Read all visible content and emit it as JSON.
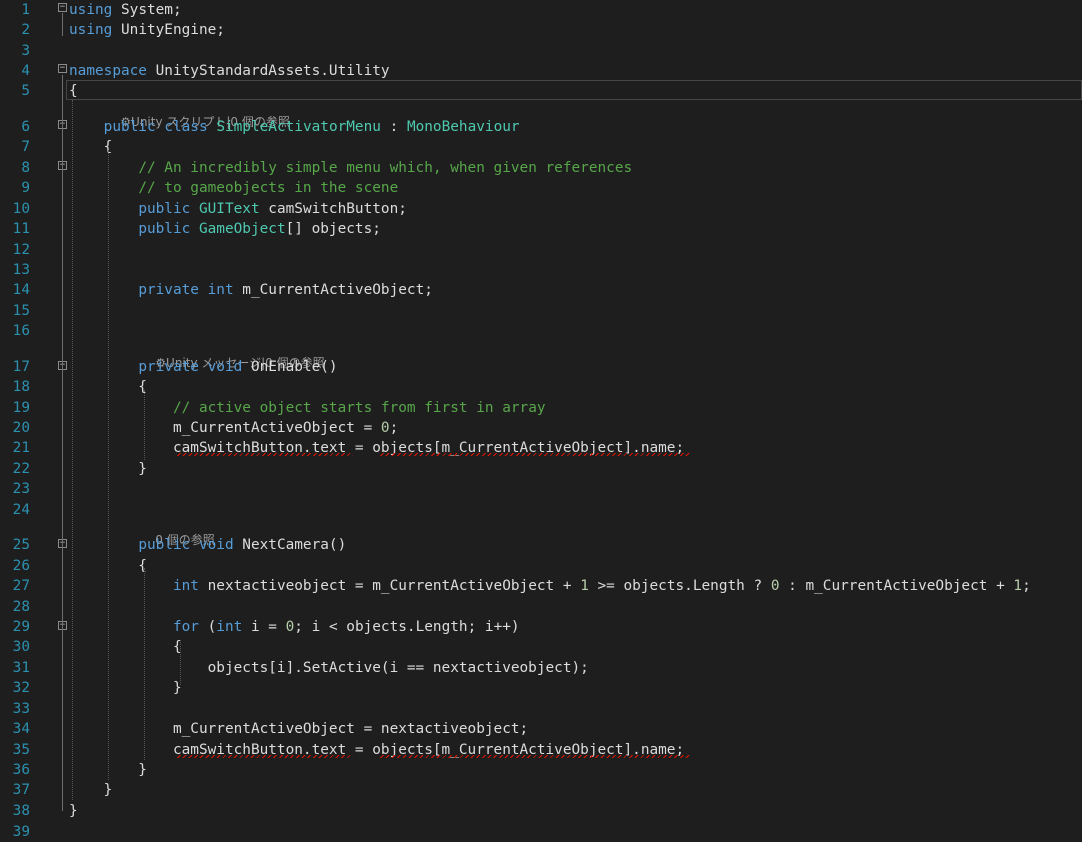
{
  "editor": {
    "lines": [
      {
        "n": "1",
        "segs": [
          {
            "t": "using",
            "c": "kw"
          },
          {
            "t": " System;",
            "c": "pl"
          }
        ]
      },
      {
        "n": "2",
        "segs": [
          {
            "t": "using",
            "c": "kw"
          },
          {
            "t": " UnityEngine;",
            "c": "pl"
          }
        ]
      },
      {
        "n": "3",
        "segs": []
      },
      {
        "n": "4",
        "segs": [
          {
            "t": "namespace",
            "c": "kw"
          },
          {
            "t": " UnityStandardAssets.Utility",
            "c": "pl"
          }
        ]
      },
      {
        "n": "5",
        "segs": [
          {
            "t": "{",
            "c": "pl"
          }
        ]
      },
      {
        "n": "6",
        "segs": [
          {
            "t": "    ",
            "c": "pl"
          },
          {
            "t": "public",
            "c": "kw"
          },
          {
            "t": " ",
            "c": "pl"
          },
          {
            "t": "class",
            "c": "kw"
          },
          {
            "t": " ",
            "c": "pl"
          },
          {
            "t": "SimpleActivatorMenu",
            "c": "ty"
          },
          {
            "t": " : ",
            "c": "pl"
          },
          {
            "t": "MonoBehaviour",
            "c": "ty"
          }
        ]
      },
      {
        "n": "7",
        "segs": [
          {
            "t": "    {",
            "c": "pl"
          }
        ]
      },
      {
        "n": "8",
        "segs": [
          {
            "t": "        ",
            "c": "pl"
          },
          {
            "t": "// An incredibly simple menu which, when given references",
            "c": "cm"
          }
        ]
      },
      {
        "n": "9",
        "segs": [
          {
            "t": "        ",
            "c": "pl"
          },
          {
            "t": "// to gameobjects in the scene",
            "c": "cm"
          }
        ]
      },
      {
        "n": "10",
        "segs": [
          {
            "t": "        ",
            "c": "pl"
          },
          {
            "t": "public",
            "c": "kw"
          },
          {
            "t": " ",
            "c": "pl"
          },
          {
            "t": "GUIText",
            "c": "ty"
          },
          {
            "t": " camSwitchButton;",
            "c": "pl"
          }
        ]
      },
      {
        "n": "11",
        "segs": [
          {
            "t": "        ",
            "c": "pl"
          },
          {
            "t": "public",
            "c": "kw"
          },
          {
            "t": " ",
            "c": "pl"
          },
          {
            "t": "GameObject",
            "c": "ty"
          },
          {
            "t": "[] objects;",
            "c": "pl"
          }
        ]
      },
      {
        "n": "12",
        "segs": []
      },
      {
        "n": "13",
        "segs": []
      },
      {
        "n": "14",
        "segs": [
          {
            "t": "        ",
            "c": "pl"
          },
          {
            "t": "private",
            "c": "kw"
          },
          {
            "t": " ",
            "c": "pl"
          },
          {
            "t": "int",
            "c": "kw"
          },
          {
            "t": " m_CurrentActiveObject;",
            "c": "pl"
          }
        ]
      },
      {
        "n": "15",
        "segs": []
      },
      {
        "n": "16",
        "segs": []
      },
      {
        "n": "17",
        "segs": [
          {
            "t": "        ",
            "c": "pl"
          },
          {
            "t": "private",
            "c": "kw"
          },
          {
            "t": " ",
            "c": "pl"
          },
          {
            "t": "void",
            "c": "kw"
          },
          {
            "t": " OnEnable()",
            "c": "pl"
          }
        ]
      },
      {
        "n": "18",
        "segs": [
          {
            "t": "        {",
            "c": "pl"
          }
        ]
      },
      {
        "n": "19",
        "segs": [
          {
            "t": "            ",
            "c": "pl"
          },
          {
            "t": "// active object starts from first in array",
            "c": "cm"
          }
        ]
      },
      {
        "n": "20",
        "segs": [
          {
            "t": "            m_CurrentActiveObject = ",
            "c": "pl"
          },
          {
            "t": "0",
            "c": "nm"
          },
          {
            "t": ";",
            "c": "pl"
          }
        ]
      },
      {
        "n": "21",
        "segs": [
          {
            "t": "            camSwitchButton.text = objects[m_CurrentActiveObject].name;",
            "c": "pl"
          }
        ]
      },
      {
        "n": "22",
        "segs": [
          {
            "t": "        }",
            "c": "pl"
          }
        ]
      },
      {
        "n": "23",
        "segs": []
      },
      {
        "n": "24",
        "segs": []
      },
      {
        "n": "25",
        "segs": [
          {
            "t": "        ",
            "c": "pl"
          },
          {
            "t": "public",
            "c": "kw"
          },
          {
            "t": " ",
            "c": "pl"
          },
          {
            "t": "void",
            "c": "kw"
          },
          {
            "t": " NextCamera()",
            "c": "pl"
          }
        ]
      },
      {
        "n": "26",
        "segs": [
          {
            "t": "        {",
            "c": "pl"
          }
        ]
      },
      {
        "n": "27",
        "segs": [
          {
            "t": "            ",
            "c": "pl"
          },
          {
            "t": "int",
            "c": "kw"
          },
          {
            "t": " nextactiveobject = m_CurrentActiveObject + ",
            "c": "pl"
          },
          {
            "t": "1",
            "c": "nm"
          },
          {
            "t": " >= objects.Length ? ",
            "c": "pl"
          },
          {
            "t": "0",
            "c": "nm"
          },
          {
            "t": " : m_CurrentActiveObject + ",
            "c": "pl"
          },
          {
            "t": "1",
            "c": "nm"
          },
          {
            "t": ";",
            "c": "pl"
          }
        ]
      },
      {
        "n": "28",
        "segs": []
      },
      {
        "n": "29",
        "segs": [
          {
            "t": "            ",
            "c": "pl"
          },
          {
            "t": "for",
            "c": "kw"
          },
          {
            "t": " (",
            "c": "pl"
          },
          {
            "t": "int",
            "c": "kw"
          },
          {
            "t": " i = ",
            "c": "pl"
          },
          {
            "t": "0",
            "c": "nm"
          },
          {
            "t": "; i < objects.Length; i++)",
            "c": "pl"
          }
        ]
      },
      {
        "n": "30",
        "segs": [
          {
            "t": "            {",
            "c": "pl"
          }
        ]
      },
      {
        "n": "31",
        "segs": [
          {
            "t": "                objects[i].SetActive(i == nextactiveobject);",
            "c": "pl"
          }
        ]
      },
      {
        "n": "32",
        "segs": [
          {
            "t": "            }",
            "c": "pl"
          }
        ]
      },
      {
        "n": "33",
        "segs": []
      },
      {
        "n": "34",
        "segs": [
          {
            "t": "            m_CurrentActiveObject = nextactiveobject;",
            "c": "pl"
          }
        ]
      },
      {
        "n": "35",
        "segs": [
          {
            "t": "            camSwitchButton.text = objects[m_CurrentActiveObject].name;",
            "c": "pl"
          }
        ]
      },
      {
        "n": "36",
        "segs": [
          {
            "t": "        }",
            "c": "pl"
          }
        ]
      },
      {
        "n": "37",
        "segs": [
          {
            "t": "    }",
            "c": "pl"
          }
        ]
      },
      {
        "n": "38",
        "segs": [
          {
            "t": "}",
            "c": "pl"
          }
        ]
      },
      {
        "n": "39",
        "segs": []
      }
    ],
    "codelens": {
      "class_lens": "Unity スクリプト|0 個の参照",
      "onenable_lens": "Unity メッセージ|0 個の参照",
      "nextcamera_lens": "0 個の参照"
    },
    "colors": {
      "keyword": "#569cd6",
      "type": "#4ec9b0",
      "comment": "#57a64a",
      "number": "#b5cea8",
      "line_number": "#2b91af",
      "background": "#1e1e1e"
    }
  }
}
